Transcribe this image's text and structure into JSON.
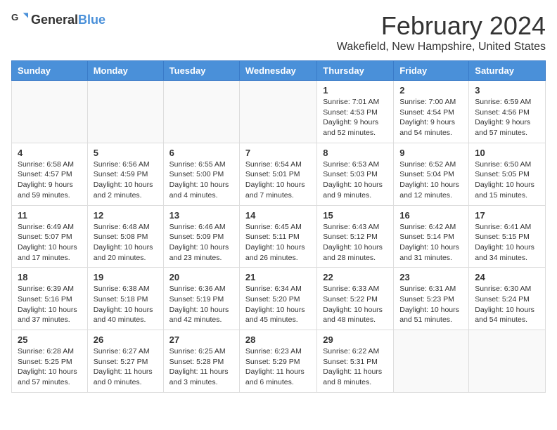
{
  "header": {
    "logo_general": "General",
    "logo_blue": "Blue",
    "title": "February 2024",
    "subtitle": "Wakefield, New Hampshire, United States"
  },
  "calendar": {
    "headers": [
      "Sunday",
      "Monday",
      "Tuesday",
      "Wednesday",
      "Thursday",
      "Friday",
      "Saturday"
    ],
    "weeks": [
      [
        {
          "day": "",
          "info": ""
        },
        {
          "day": "",
          "info": ""
        },
        {
          "day": "",
          "info": ""
        },
        {
          "day": "",
          "info": ""
        },
        {
          "day": "1",
          "info": "Sunrise: 7:01 AM\nSunset: 4:53 PM\nDaylight: 9 hours\nand 52 minutes."
        },
        {
          "day": "2",
          "info": "Sunrise: 7:00 AM\nSunset: 4:54 PM\nDaylight: 9 hours\nand 54 minutes."
        },
        {
          "day": "3",
          "info": "Sunrise: 6:59 AM\nSunset: 4:56 PM\nDaylight: 9 hours\nand 57 minutes."
        }
      ],
      [
        {
          "day": "4",
          "info": "Sunrise: 6:58 AM\nSunset: 4:57 PM\nDaylight: 9 hours\nand 59 minutes."
        },
        {
          "day": "5",
          "info": "Sunrise: 6:56 AM\nSunset: 4:59 PM\nDaylight: 10 hours\nand 2 minutes."
        },
        {
          "day": "6",
          "info": "Sunrise: 6:55 AM\nSunset: 5:00 PM\nDaylight: 10 hours\nand 4 minutes."
        },
        {
          "day": "7",
          "info": "Sunrise: 6:54 AM\nSunset: 5:01 PM\nDaylight: 10 hours\nand 7 minutes."
        },
        {
          "day": "8",
          "info": "Sunrise: 6:53 AM\nSunset: 5:03 PM\nDaylight: 10 hours\nand 9 minutes."
        },
        {
          "day": "9",
          "info": "Sunrise: 6:52 AM\nSunset: 5:04 PM\nDaylight: 10 hours\nand 12 minutes."
        },
        {
          "day": "10",
          "info": "Sunrise: 6:50 AM\nSunset: 5:05 PM\nDaylight: 10 hours\nand 15 minutes."
        }
      ],
      [
        {
          "day": "11",
          "info": "Sunrise: 6:49 AM\nSunset: 5:07 PM\nDaylight: 10 hours\nand 17 minutes."
        },
        {
          "day": "12",
          "info": "Sunrise: 6:48 AM\nSunset: 5:08 PM\nDaylight: 10 hours\nand 20 minutes."
        },
        {
          "day": "13",
          "info": "Sunrise: 6:46 AM\nSunset: 5:09 PM\nDaylight: 10 hours\nand 23 minutes."
        },
        {
          "day": "14",
          "info": "Sunrise: 6:45 AM\nSunset: 5:11 PM\nDaylight: 10 hours\nand 26 minutes."
        },
        {
          "day": "15",
          "info": "Sunrise: 6:43 AM\nSunset: 5:12 PM\nDaylight: 10 hours\nand 28 minutes."
        },
        {
          "day": "16",
          "info": "Sunrise: 6:42 AM\nSunset: 5:14 PM\nDaylight: 10 hours\nand 31 minutes."
        },
        {
          "day": "17",
          "info": "Sunrise: 6:41 AM\nSunset: 5:15 PM\nDaylight: 10 hours\nand 34 minutes."
        }
      ],
      [
        {
          "day": "18",
          "info": "Sunrise: 6:39 AM\nSunset: 5:16 PM\nDaylight: 10 hours\nand 37 minutes."
        },
        {
          "day": "19",
          "info": "Sunrise: 6:38 AM\nSunset: 5:18 PM\nDaylight: 10 hours\nand 40 minutes."
        },
        {
          "day": "20",
          "info": "Sunrise: 6:36 AM\nSunset: 5:19 PM\nDaylight: 10 hours\nand 42 minutes."
        },
        {
          "day": "21",
          "info": "Sunrise: 6:34 AM\nSunset: 5:20 PM\nDaylight: 10 hours\nand 45 minutes."
        },
        {
          "day": "22",
          "info": "Sunrise: 6:33 AM\nSunset: 5:22 PM\nDaylight: 10 hours\nand 48 minutes."
        },
        {
          "day": "23",
          "info": "Sunrise: 6:31 AM\nSunset: 5:23 PM\nDaylight: 10 hours\nand 51 minutes."
        },
        {
          "day": "24",
          "info": "Sunrise: 6:30 AM\nSunset: 5:24 PM\nDaylight: 10 hours\nand 54 minutes."
        }
      ],
      [
        {
          "day": "25",
          "info": "Sunrise: 6:28 AM\nSunset: 5:25 PM\nDaylight: 10 hours\nand 57 minutes."
        },
        {
          "day": "26",
          "info": "Sunrise: 6:27 AM\nSunset: 5:27 PM\nDaylight: 11 hours\nand 0 minutes."
        },
        {
          "day": "27",
          "info": "Sunrise: 6:25 AM\nSunset: 5:28 PM\nDaylight: 11 hours\nand 3 minutes."
        },
        {
          "day": "28",
          "info": "Sunrise: 6:23 AM\nSunset: 5:29 PM\nDaylight: 11 hours\nand 6 minutes."
        },
        {
          "day": "29",
          "info": "Sunrise: 6:22 AM\nSunset: 5:31 PM\nDaylight: 11 hours\nand 8 minutes."
        },
        {
          "day": "",
          "info": ""
        },
        {
          "day": "",
          "info": ""
        }
      ]
    ]
  }
}
